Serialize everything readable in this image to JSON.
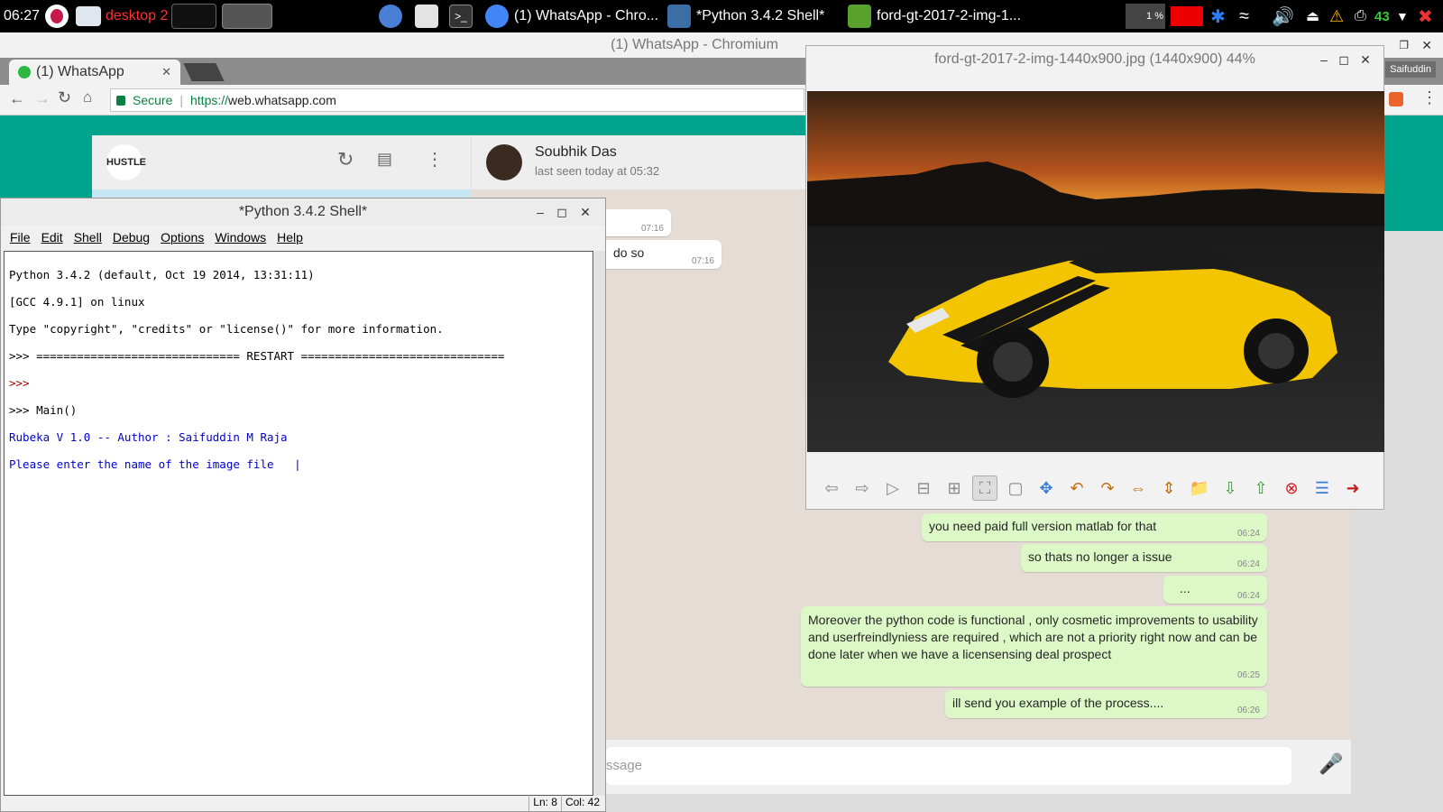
{
  "taskbar": {
    "time": "06:27",
    "desktop": "desktop 2",
    "tasks": [
      {
        "label": "(1) WhatsApp - Chro..."
      },
      {
        "label": "*Python 3.4.2 Shell*"
      },
      {
        "label": "ford-gt-2017-2-img-1..."
      }
    ],
    "cpu": "1 %",
    "temp": "43"
  },
  "chrome": {
    "window_title": "(1) WhatsApp - Chromium",
    "tab_label": "(1) WhatsApp",
    "secure_label": "Secure",
    "url_scheme": "https://",
    "url_host": "web.whatsapp.com",
    "profile": "Saifuddin"
  },
  "whatsapp": {
    "logo": "HUSTLE",
    "contact_name": "Soubhik Das",
    "last_seen": "last seen today at 05:32",
    "incoming": [
      {
        "text": "",
        "time": "07:16"
      },
      {
        "text": "do so",
        "time": "07:16"
      }
    ],
    "outgoing": [
      {
        "text": "you need paid full version matlab for that",
        "time": "06:24"
      },
      {
        "text": "so thats no longer a issue",
        "time": "06:24"
      },
      {
        "text": "...",
        "time": "06:24"
      },
      {
        "text": "Moreover the python code is functional , only cosmetic improvements to usability and userfreindlyniess are required , which are not a priority right now and can be done later when we have a licensensing deal prospect",
        "time": "06:25"
      },
      {
        "text": "ill send you example of the process....",
        "time": "06:26"
      }
    ],
    "compose_placeholder": "ssage"
  },
  "python_shell": {
    "title": "*Python 3.4.2 Shell*",
    "menu": [
      "File",
      "Edit",
      "Shell",
      "Debug",
      "Options",
      "Windows",
      "Help"
    ],
    "lines": [
      {
        "text": "Python 3.4.2 (default, Oct 19 2014, 13:31:11)",
        "style": "dark"
      },
      {
        "text": "[GCC 4.9.1] on linux",
        "style": "dark"
      },
      {
        "text": "Type \"copyright\", \"credits\" or \"license()\" for more information.",
        "style": "dark"
      },
      {
        "text": ">>> ============================== RESTART ==============================",
        "style": "dark"
      },
      {
        "text": ">>>",
        "style": "red"
      },
      {
        "text": ">>> Main()",
        "style": "dark"
      },
      {
        "text": "Rubeka V 1.0 -- Author : Saifuddin M Raja",
        "style": "blue"
      },
      {
        "text": "Please enter the name of the image file   |",
        "style": "blue"
      }
    ],
    "status_ln": "Ln: 8",
    "status_col": "Col: 42"
  },
  "image_viewer": {
    "title": "ford-gt-2017-2-img-1440x900.jpg (1440x900) 44%"
  }
}
